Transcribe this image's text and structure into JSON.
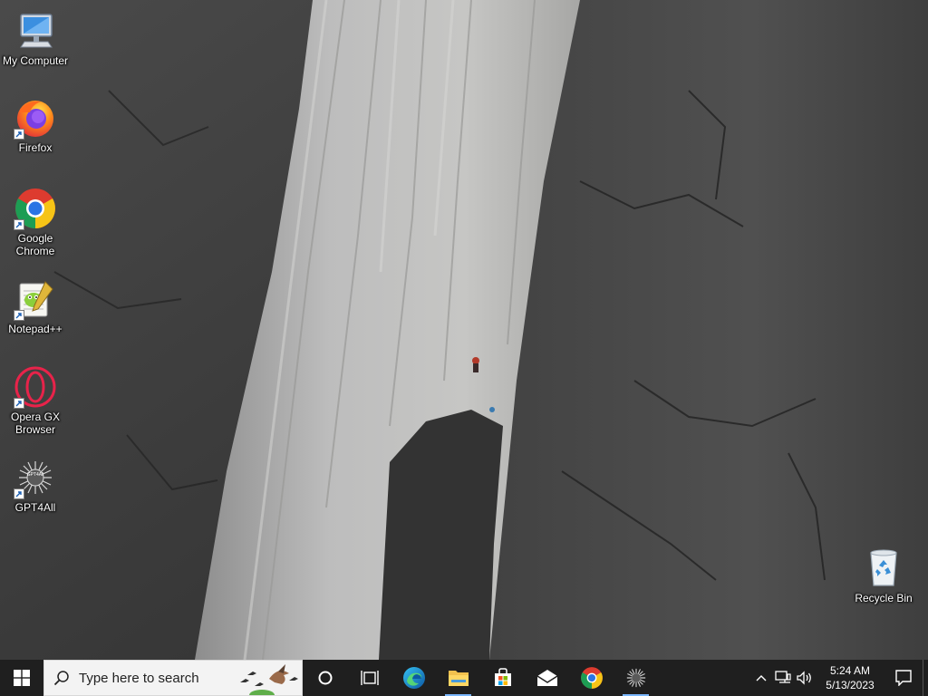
{
  "desktop": {
    "icons": [
      {
        "label": "My Computer",
        "icon": "computer-icon",
        "shortcut": false
      },
      {
        "label": "Firefox",
        "icon": "firefox-icon",
        "shortcut": true
      },
      {
        "label": "Google\nChrome",
        "icon": "chrome-icon",
        "shortcut": true
      },
      {
        "label": "Notepad++",
        "icon": "notepadpp-icon",
        "shortcut": true
      },
      {
        "label": "Opera GX\nBrowser",
        "icon": "opera-gx-icon",
        "shortcut": true
      },
      {
        "label": "GPT4All",
        "icon": "gpt4all-icon",
        "shortcut": true
      },
      {
        "label": "Recycle Bin",
        "icon": "recycle-bin-icon",
        "shortcut": false
      }
    ],
    "gpt4all_logo_text": "GPT4All"
  },
  "taskbar": {
    "search_placeholder": "Type here to search",
    "pinned": [
      {
        "name": "cortana",
        "icon": "cortana-circle-icon",
        "active": false
      },
      {
        "name": "task-view",
        "icon": "task-view-icon",
        "active": false
      },
      {
        "name": "edge",
        "icon": "edge-icon",
        "active": false
      },
      {
        "name": "file-explorer",
        "icon": "folder-icon",
        "active": true
      },
      {
        "name": "microsoft-store",
        "icon": "store-icon",
        "active": false
      },
      {
        "name": "mail",
        "icon": "mail-icon",
        "active": false
      },
      {
        "name": "chrome",
        "icon": "chrome-icon",
        "active": false
      },
      {
        "name": "gpt4all",
        "icon": "gpt4all-icon",
        "active": true
      }
    ],
    "tray": {
      "icons": [
        "chevron-up-icon",
        "network-icon",
        "volume-icon"
      ],
      "time": "5:24 AM",
      "date": "5/13/2023"
    }
  },
  "colors": {
    "taskbar_bg": "#1f1f1f",
    "active_indicator": "#7ab7ff",
    "search_bg": "#f3f3f3"
  }
}
